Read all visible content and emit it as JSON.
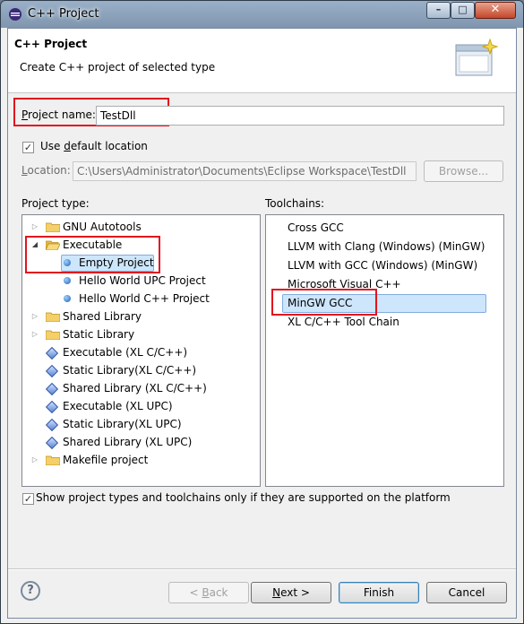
{
  "window": {
    "title": "C++ Project",
    "controls": {
      "minimize": "–",
      "maximize": "□",
      "close": "✕"
    }
  },
  "banner": {
    "title": "C++ Project",
    "description": "Create C++ project of selected type"
  },
  "project_name": {
    "label_prefix": "P",
    "label_rest": "roject name:",
    "value": "TestDll"
  },
  "default_location": {
    "checked": true,
    "label_a": "Use ",
    "label_u": "d",
    "label_b": "efault location"
  },
  "location": {
    "label_prefix": "L",
    "label_rest": "ocation:",
    "value": "C:\\Users\\Administrator\\Documents\\Eclipse Workspace\\TestDll",
    "browse": "Browse..."
  },
  "project_type": {
    "heading": "Project type:",
    "items": [
      {
        "label": "GNU Autotools"
      },
      {
        "label": "Executable"
      },
      {
        "label": "Empty Project"
      },
      {
        "label": "Hello World UPC Project"
      },
      {
        "label": "Hello World C++ Project"
      },
      {
        "label": "Shared Library"
      },
      {
        "label": "Static Library"
      },
      {
        "label": "Executable (XL C/C++)"
      },
      {
        "label": "Static Library(XL C/C++)"
      },
      {
        "label": "Shared Library (XL C/C++)"
      },
      {
        "label": "Executable (XL UPC)"
      },
      {
        "label": "Static Library(XL UPC)"
      },
      {
        "label": "Shared Library (XL UPC)"
      },
      {
        "label": "Makefile project"
      }
    ]
  },
  "toolchains": {
    "heading": "Toolchains:",
    "items": [
      {
        "label": "Cross GCC"
      },
      {
        "label": "LLVM with Clang (Windows) (MinGW)"
      },
      {
        "label": "LLVM with GCC (Windows) (MinGW)"
      },
      {
        "label": "Microsoft Visual C++"
      },
      {
        "label": "MinGW GCC"
      },
      {
        "label": "XL C/C++ Tool Chain"
      }
    ],
    "selected": "MinGW GCC"
  },
  "show_supported": {
    "checked": true,
    "label": "Show project types and toolchains only if they are supported on the platform"
  },
  "buttons": {
    "help": "?",
    "back_a": "< ",
    "back_u": "B",
    "back_b": "ack",
    "next_u": "N",
    "next_b": "ext >",
    "finish": "Finish",
    "cancel": "Cancel"
  },
  "colors": {
    "annotation": "#e0141e",
    "selection": "#cde6fb"
  }
}
